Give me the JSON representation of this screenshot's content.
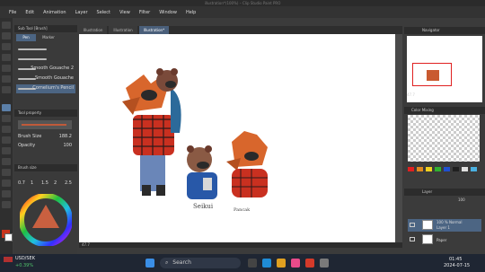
{
  "window": {
    "title": "illustration*(100%) – Clip Studio Paint PRO"
  },
  "menu": [
    "File",
    "Edit",
    "Animation",
    "Layer",
    "Select",
    "View",
    "Filter",
    "Window",
    "Help"
  ],
  "canvas_tabs": [
    {
      "label": "Illustration",
      "active": false
    },
    {
      "label": "Illustration",
      "active": false
    },
    {
      "label": "Illustration*",
      "active": true
    }
  ],
  "subtool": {
    "header": "Sub Tool [Brush]",
    "tabs": [
      "Pen",
      "Marker"
    ],
    "brushes": [
      {
        "label": ""
      },
      {
        "label": ""
      },
      {
        "label": "Smooth Gouache 2",
        "selected": false
      },
      {
        "label": "Smooth Gouache",
        "selected": false
      },
      {
        "label": "Cornelium's Pencil",
        "selected": true
      }
    ]
  },
  "tool_property": {
    "header": "Tool property",
    "brush_size_label": "Brush Size",
    "brush_size_value": "188.2",
    "opacity_label": "Opacity",
    "opacity_value": "100"
  },
  "brush_size_panel": {
    "header": "Brush size",
    "values": [
      "0.7",
      "1",
      "1.5",
      "2",
      "2.5"
    ]
  },
  "canvas": {
    "signature_text_1": "Seikui",
    "signature_text_2": "Pancak"
  },
  "statusbar": {
    "zoom": "47.7"
  },
  "navigator": {
    "header": "Navigator",
    "zoom": "47.7"
  },
  "color_mixing": {
    "header": "Color Mixing"
  },
  "swatches": [
    "#e02020",
    "#e08a20",
    "#f0d020",
    "#30b030",
    "#2050d0",
    "#202020",
    "#e0e0e0",
    "#4ab0e0"
  ],
  "layers": {
    "header": "Layer",
    "opacity": "100",
    "rows": [
      {
        "title": "100 % Normal",
        "name": "Layer 1",
        "selected": true
      },
      {
        "title": "",
        "name": "Paper",
        "selected": false
      }
    ]
  },
  "taskbar": {
    "weather_label": "USD/SEK",
    "weather_value": "+0.39%",
    "search_placeholder": "Search",
    "time": "01:45",
    "date": "2024-07-15"
  }
}
